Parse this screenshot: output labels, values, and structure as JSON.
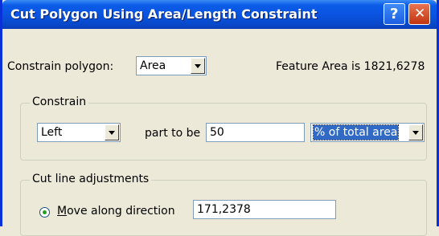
{
  "window": {
    "title": "Cut Polygon Using Area/Length Constraint",
    "help_glyph": "?",
    "close_glyph": "✕"
  },
  "constrain_polygon": {
    "label": "Constrain polygon:",
    "selected": "Area"
  },
  "feature_area": {
    "text": "Feature Area is 1821,6278"
  },
  "constrain_group": {
    "title": "Constrain",
    "side_selected": "Left",
    "part_label": "part to be",
    "value": "50",
    "unit_selected": "% of total area"
  },
  "adjustments_group": {
    "title": "Cut line adjustments",
    "move_mnemonic": "M",
    "move_label_rest": "ove along direction",
    "move_value": "171,2378",
    "move_checked": true
  },
  "colors": {
    "title_bar": "#0a54e0",
    "window_bg": "#ece9d8",
    "selection": "#316ac5",
    "close_button": "#c23510"
  }
}
